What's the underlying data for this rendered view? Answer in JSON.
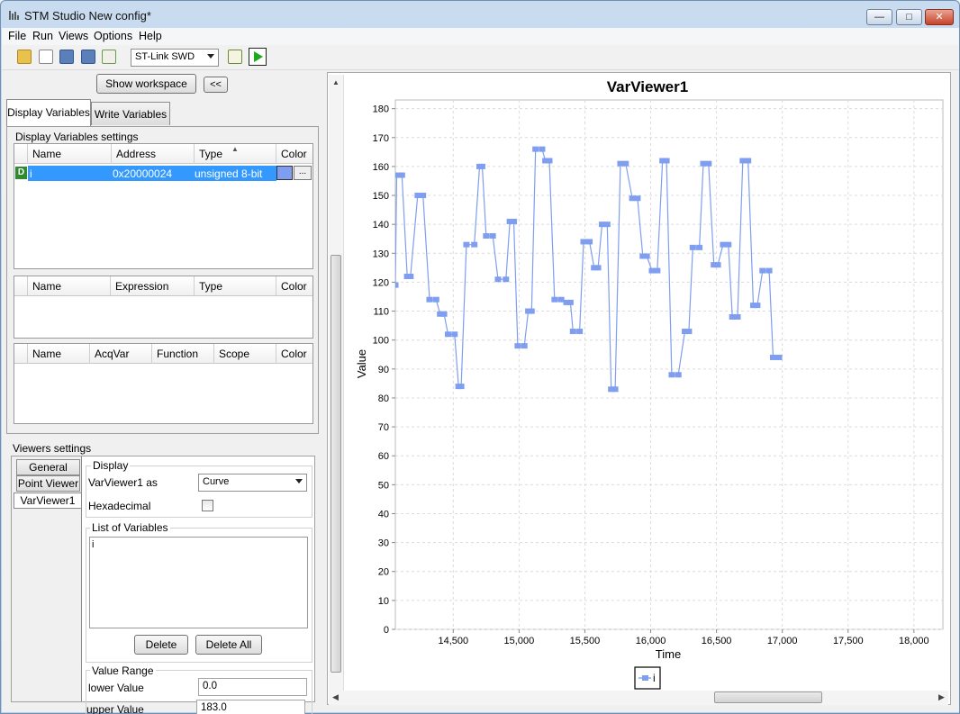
{
  "window": {
    "title": "STM Studio New config*",
    "min": "—",
    "max": "□",
    "close": "✕"
  },
  "menu": [
    "File",
    "Run",
    "Views",
    "Options",
    "Help"
  ],
  "toolbar": {
    "connection": "ST-Link SWD",
    "icons": [
      "open-folder-icon",
      "new-file-icon",
      "save-multiple-icon",
      "save-icon",
      "export-icon",
      "table-icon",
      "run-icon"
    ]
  },
  "workspace": {
    "show_label": "Show workspace",
    "collapse_label": "<<"
  },
  "tabs": {
    "display": "Display Variables",
    "write": "Write Variables"
  },
  "display_settings": {
    "title": "Display Variables settings",
    "columns": [
      "Name",
      "Address",
      "Type",
      "Color"
    ],
    "rows": [
      {
        "flag": "D",
        "name": "i",
        "address": "0x20000024",
        "type": "unsigned 8-bit",
        "color": "#7f9ef0",
        "more": "..."
      }
    ]
  },
  "expr_table": {
    "columns": [
      "Name",
      "Expression",
      "Type",
      "Color"
    ]
  },
  "acq_table": {
    "columns": [
      "Name",
      "AcqVar",
      "Function",
      "Scope",
      "Color"
    ]
  },
  "viewers": {
    "title": "Viewers settings",
    "tabs": [
      "General",
      "Point Viewer",
      "VarViewer1"
    ],
    "display_group": "Display",
    "as_label": "VarViewer1 as",
    "as_value": "Curve",
    "hex_label": "Hexadecimal",
    "hex_checked": false,
    "list_group": "List of Variables",
    "list_items": [
      "i"
    ],
    "delete_label": "Delete",
    "delete_all_label": "Delete All",
    "range_group": "Value Range",
    "lower_label": "lower Value",
    "lower_value": "0.0",
    "upper_label": "upper Value",
    "upper_value": "183.0"
  },
  "chart_data": {
    "type": "line",
    "title": "VarViewer1",
    "xlabel": "Time",
    "ylabel": "Value",
    "xlim": [
      14060,
      18220
    ],
    "ylim": [
      0,
      183
    ],
    "yticks": [
      0,
      10,
      20,
      30,
      40,
      50,
      60,
      70,
      80,
      90,
      100,
      110,
      120,
      130,
      140,
      150,
      160,
      170,
      180
    ],
    "xticks": [
      14500,
      15000,
      15500,
      16000,
      16500,
      17000,
      17500,
      18000
    ],
    "xtick_labels": [
      "14,500",
      "15,000",
      "15,500",
      "16,000",
      "16,500",
      "17,000",
      "17,500",
      "18,000"
    ],
    "grid": true,
    "legend": "bottom",
    "series": [
      {
        "name": "i",
        "color": "#7f9ef0",
        "points": [
          [
            14060,
            119
          ],
          [
            14070,
            157
          ],
          [
            14110,
            157
          ],
          [
            14150,
            122
          ],
          [
            14175,
            122
          ],
          [
            14230,
            150
          ],
          [
            14270,
            150
          ],
          [
            14320,
            114
          ],
          [
            14370,
            114
          ],
          [
            14400,
            109
          ],
          [
            14430,
            109
          ],
          [
            14460,
            102
          ],
          [
            14510,
            102
          ],
          [
            14540,
            84
          ],
          [
            14560,
            84
          ],
          [
            14600,
            133
          ],
          [
            14660,
            133
          ],
          [
            14700,
            160
          ],
          [
            14720,
            160
          ],
          [
            14750,
            136
          ],
          [
            14800,
            136
          ],
          [
            14840,
            121
          ],
          [
            14900,
            121
          ],
          [
            14930,
            141
          ],
          [
            14960,
            141
          ],
          [
            14990,
            98
          ],
          [
            15040,
            98
          ],
          [
            15070,
            110
          ],
          [
            15095,
            110
          ],
          [
            15125,
            166
          ],
          [
            15175,
            166
          ],
          [
            15200,
            162
          ],
          [
            15230,
            162
          ],
          [
            15270,
            114
          ],
          [
            15320,
            114
          ],
          [
            15360,
            113
          ],
          [
            15390,
            113
          ],
          [
            15410,
            103
          ],
          [
            15460,
            103
          ],
          [
            15490,
            134
          ],
          [
            15535,
            134
          ],
          [
            15570,
            125
          ],
          [
            15600,
            125
          ],
          [
            15630,
            140
          ],
          [
            15670,
            140
          ],
          [
            15700,
            83
          ],
          [
            15730,
            83
          ],
          [
            15770,
            161
          ],
          [
            15810,
            161
          ],
          [
            15860,
            149
          ],
          [
            15900,
            149
          ],
          [
            15940,
            129
          ],
          [
            15970,
            129
          ],
          [
            16010,
            124
          ],
          [
            16050,
            124
          ],
          [
            16090,
            162
          ],
          [
            16120,
            162
          ],
          [
            16160,
            88
          ],
          [
            16210,
            88
          ],
          [
            16260,
            103
          ],
          [
            16290,
            103
          ],
          [
            16320,
            132
          ],
          [
            16370,
            132
          ],
          [
            16400,
            161
          ],
          [
            16440,
            161
          ],
          [
            16480,
            126
          ],
          [
            16510,
            126
          ],
          [
            16550,
            133
          ],
          [
            16590,
            133
          ],
          [
            16620,
            108
          ],
          [
            16660,
            108
          ],
          [
            16700,
            162
          ],
          [
            16740,
            162
          ],
          [
            16780,
            112
          ],
          [
            16810,
            112
          ],
          [
            16850,
            124
          ],
          [
            16900,
            124
          ],
          [
            16930,
            94
          ],
          [
            16975,
            94
          ]
        ]
      }
    ]
  }
}
